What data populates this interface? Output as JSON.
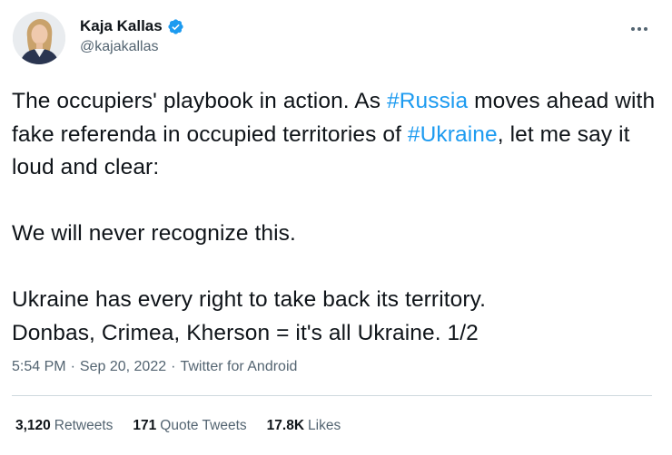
{
  "author": {
    "display_name": "Kaja Kallas",
    "handle": "@kajakallas",
    "verified": true
  },
  "tweet": {
    "line1_pre": "The occupiers' playbook in action. As ",
    "hashtag1": "#Russia",
    "line1_post": " moves ahead with fake referenda in occupied territories of ",
    "hashtag2": "#Ukraine",
    "line2_post": ", let me say it loud and clear:",
    "para2": "We will never recognize this.",
    "para3_line1": "Ukraine has every right to take back its territory.",
    "para3_line2": "Donbas, Crimea, Kherson = it's all Ukraine. 1/2"
  },
  "meta": {
    "time": "5:54 PM",
    "separator": "·",
    "date": "Sep 20, 2022",
    "source": "Twitter for Android"
  },
  "stats": [
    {
      "count": "3,120",
      "label": "Retweets"
    },
    {
      "count": "171",
      "label": "Quote Tweets"
    },
    {
      "count": "17.8K",
      "label": "Likes"
    }
  ],
  "colors": {
    "link": "#1d9bf0",
    "text": "#0f1419",
    "secondary": "#536471",
    "divider": "#cfd9de"
  },
  "icons": {
    "verified": "verified-badge-icon",
    "more": "more-options-icon"
  }
}
